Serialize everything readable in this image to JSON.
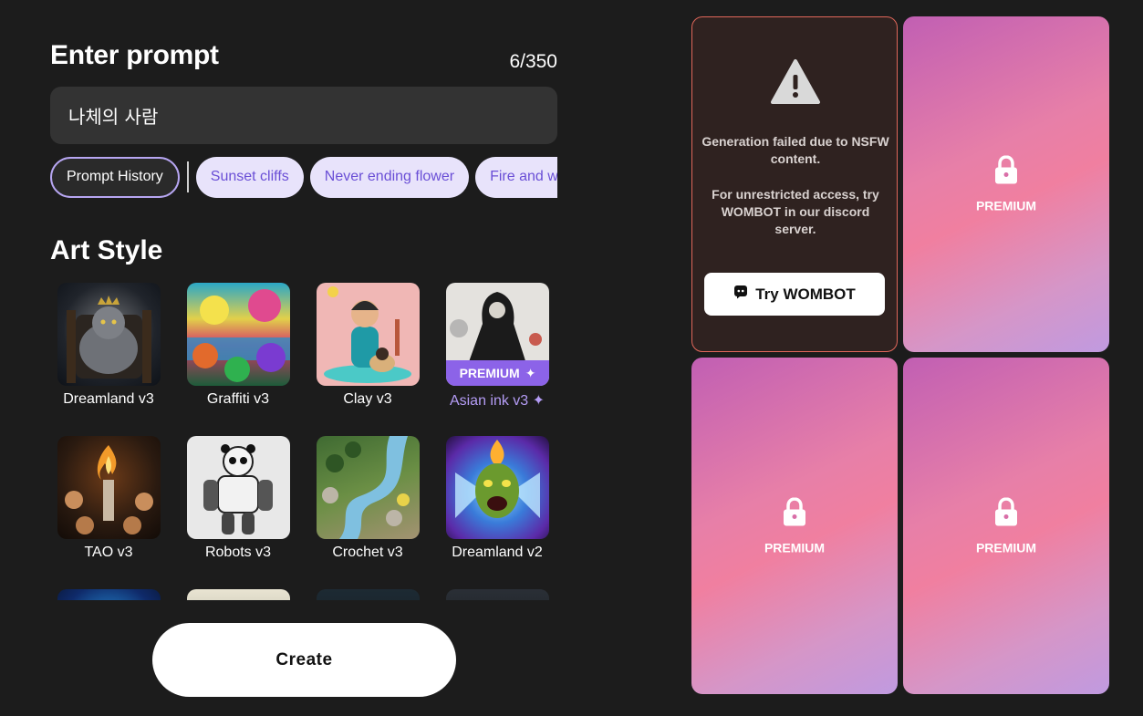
{
  "prompt": {
    "title": "Enter prompt",
    "char_count": "6/350",
    "value": "나체의 사람"
  },
  "chips": {
    "history_label": "Prompt History",
    "suggestions": [
      "Sunset cliffs",
      "Never ending flower",
      "Fire and water"
    ]
  },
  "art_style": {
    "title": "Art Style",
    "premium_tag": "PREMIUM",
    "styles": [
      {
        "label": "Dreamland v3",
        "premium": false
      },
      {
        "label": "Graffiti v3",
        "premium": false
      },
      {
        "label": "Clay v3",
        "premium": false
      },
      {
        "label": "Asian ink v3 ✦",
        "premium": true
      },
      {
        "label": "TAO v3",
        "premium": false
      },
      {
        "label": "Robots v3",
        "premium": false
      },
      {
        "label": "Crochet v3",
        "premium": false
      },
      {
        "label": "Dreamland v2",
        "premium": false
      }
    ]
  },
  "create_button": "Create",
  "results": {
    "failed": {
      "message": "Generation failed due to NSFW content.",
      "detail": "For unrestricted access, try WOMBOT in our discord server.",
      "button": "Try WOMBOT"
    },
    "premium_label": "PREMIUM"
  },
  "colors": {
    "background": "#1c1c1c",
    "accent": "#8c63e8",
    "chip_text": "#6a4fd6",
    "failed_border": "#e0675a"
  }
}
